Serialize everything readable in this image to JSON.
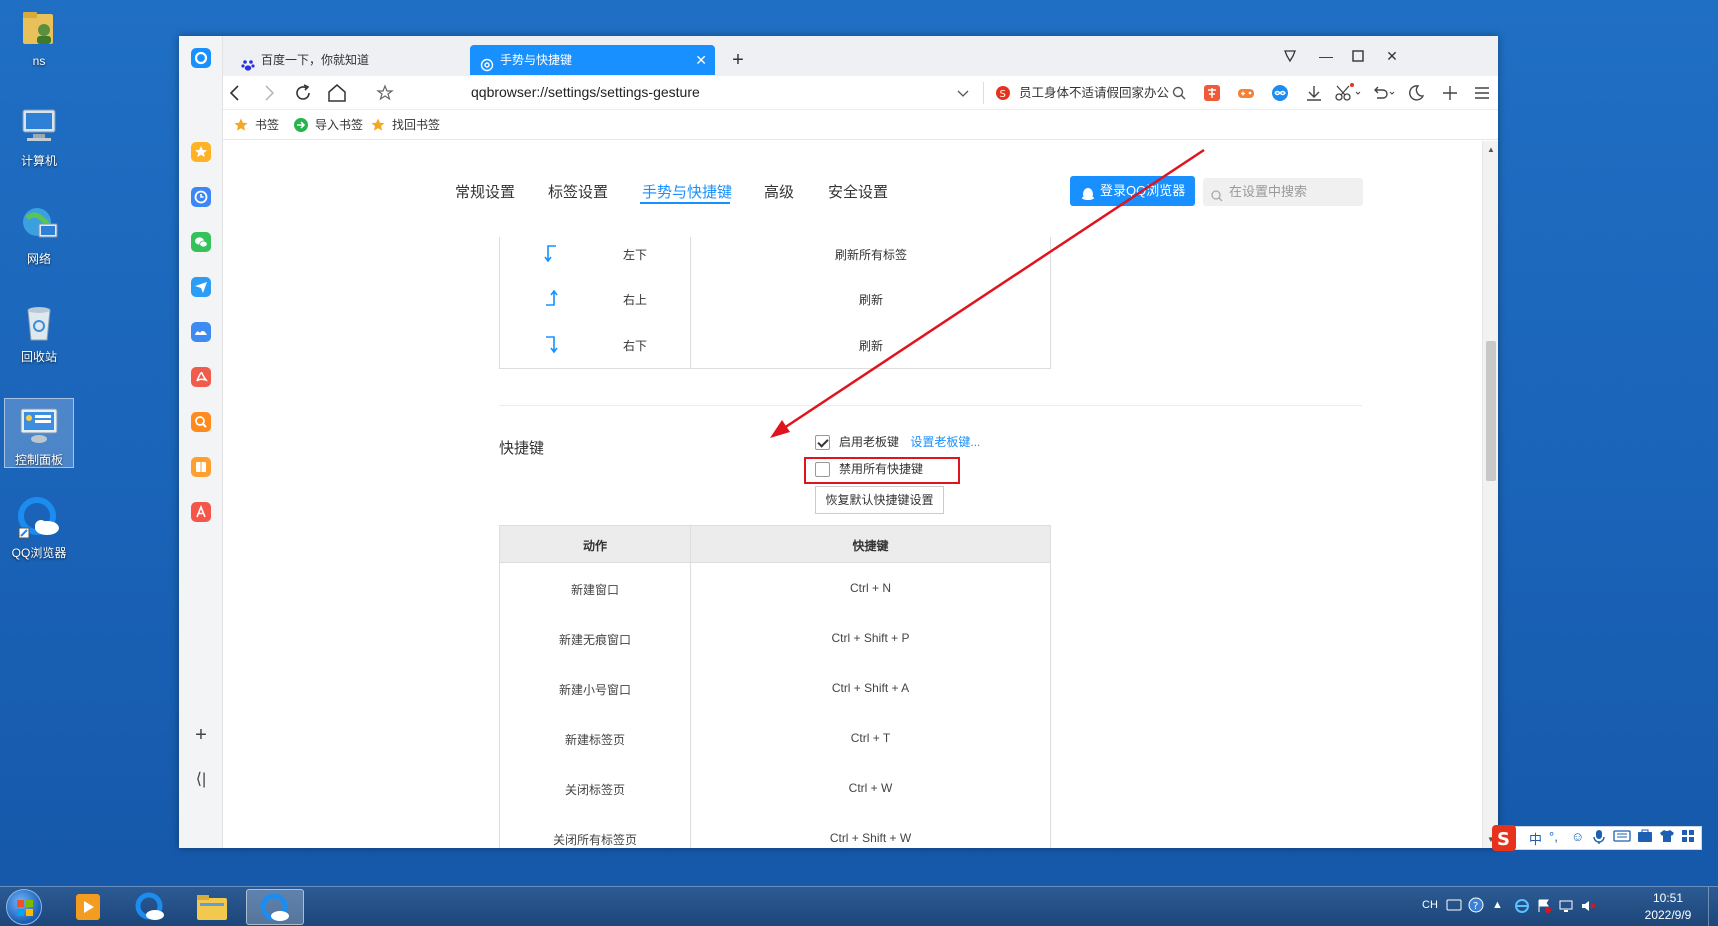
{
  "desktop": {
    "icons": [
      {
        "label": "ns"
      },
      {
        "label": "计算机"
      },
      {
        "label": "网络"
      },
      {
        "label": "回收站"
      },
      {
        "label": "控制面板"
      },
      {
        "label": "QQ浏览器"
      }
    ]
  },
  "browser": {
    "tabs": [
      {
        "title": "百度一下，你就知道",
        "icon": "baidu-paw-icon"
      },
      {
        "title": "手势与快捷键",
        "icon": "settings-gear-icon",
        "close": "✕"
      }
    ],
    "new_tab": "+",
    "address": "qqbrowser://settings/settings-gesture",
    "top_search": "员工身体不适请假回家办公",
    "bookmarks": [
      {
        "label": "书签"
      },
      {
        "label": "导入书签"
      },
      {
        "label": "找回书签"
      }
    ]
  },
  "settings": {
    "tabs": [
      "常规设置",
      "标签设置",
      "手势与快捷键",
      "高级",
      "安全设置"
    ],
    "active_tab": "手势与快捷键",
    "login_button": "登录QQ浏览器",
    "search_placeholder": "在设置中搜索",
    "gestures": [
      {
        "name": "左下",
        "action": "刷新所有标签"
      },
      {
        "name": "右上",
        "action": "刷新"
      },
      {
        "name": "右下",
        "action": "刷新"
      }
    ],
    "shortcuts_section": "快捷键",
    "boss_key_label": "启用老板键",
    "boss_key_checked": true,
    "boss_key_link": "设置老板键...",
    "disable_all_label": "禁用所有快捷键",
    "disable_all_checked": false,
    "restore_button": "恢复默认快捷键设置",
    "shortcut_table": {
      "headers": [
        "动作",
        "快捷键"
      ],
      "rows": [
        {
          "action": "新建窗口",
          "key": "Ctrl + N"
        },
        {
          "action": "新建无痕窗口",
          "key": "Ctrl + Shift + P"
        },
        {
          "action": "新建小号窗口",
          "key": "Ctrl + Shift + A"
        },
        {
          "action": "新建标签页",
          "key": "Ctrl + T"
        },
        {
          "action": "关闭标签页",
          "key": "Ctrl + W"
        },
        {
          "action": "关闭所有标签页",
          "key": "Ctrl + Shift + W"
        }
      ]
    }
  },
  "ime": {
    "mode": "中",
    "punct": "°,"
  },
  "taskbar": {
    "lang": "CH",
    "time": "10:51",
    "date": "2022/9/9"
  },
  "colors": {
    "accent": "#1890ff",
    "annotation_red": "#e0141e"
  }
}
